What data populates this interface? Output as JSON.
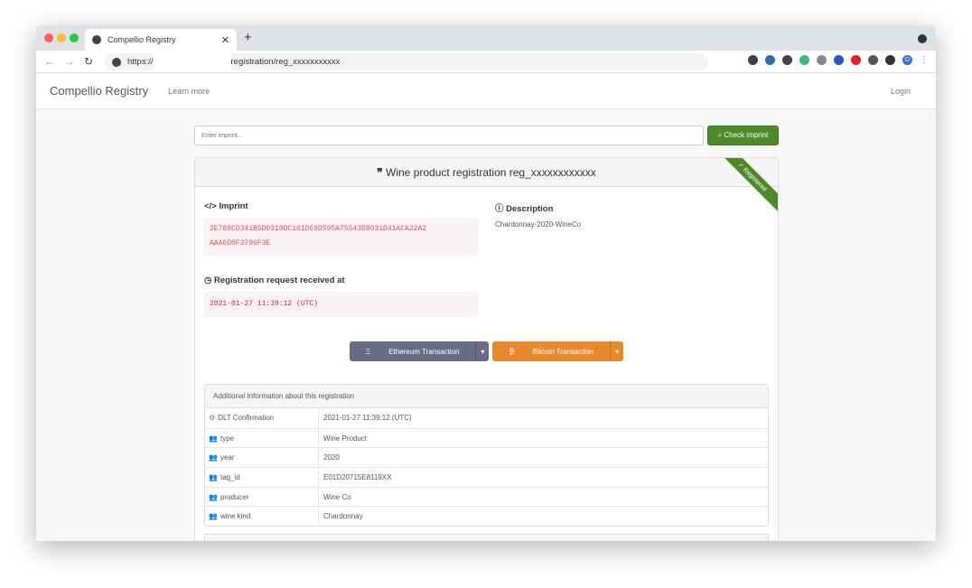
{
  "browser": {
    "tab_title": "Compellio Registry",
    "url_prefix": "https://",
    "url_suffix": "registration/reg_xxxxxxxxxxx",
    "profile_initial": "D"
  },
  "navbar": {
    "brand": "Compellio Registry",
    "learn_more": "Learn more",
    "login": "Login"
  },
  "search": {
    "placeholder": "Enter imprint...",
    "button": "Check imprint"
  },
  "panel": {
    "title": "Wine product registration reg_xxxxxxxxxxxx",
    "ribbon": "Registered",
    "imprint_label": "Imprint",
    "imprint_line1": "2E788CD341B5D0310DC101D69D595A75543D8031D41ACA22A2",
    "imprint_line2": "AAA6D0F3796F3E",
    "description_label": "Description",
    "description": "Chardonnay-2020-WineCo",
    "received_label": "Registration request received at",
    "received": "2021-01-27 11:39:12 (UTC)",
    "eth_button": "Ethereum Transaction",
    "btc_button": "Bitcoin Transaction"
  },
  "info": {
    "heading": "Additional Information about this registration",
    "rows": [
      {
        "key": "DLT Confirmation",
        "value": "2021-01-27 11:39:12 (UTC)"
      },
      {
        "key": "type",
        "value": "Wine Product"
      },
      {
        "key": "year",
        "value": "2020"
      },
      {
        "key": "tag_id",
        "value": "E01D20715E8119XX"
      },
      {
        "key": "producer",
        "value": "Wine Co"
      },
      {
        "key": "wine kind",
        "value": "Chardonnay"
      }
    ]
  }
}
